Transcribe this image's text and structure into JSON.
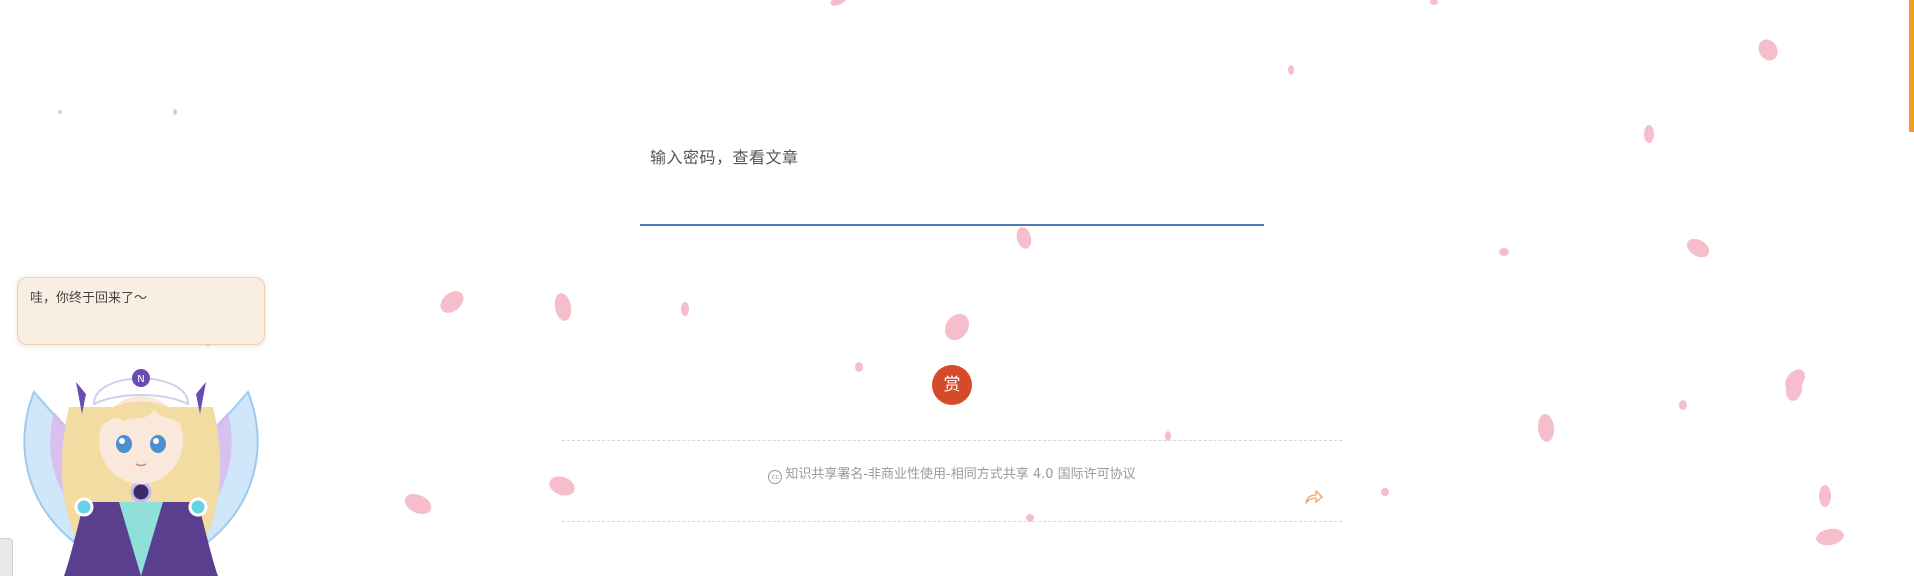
{
  "password_form": {
    "label": "输入密码，查看文章",
    "input_value": ""
  },
  "donate": {
    "label": "赏",
    "color": "#d44a2a"
  },
  "license": {
    "icon": "creative-commons-icon",
    "text": "知识共享署名-非商业性使用-相同方式共享 4.0 国际许可协议",
    "share_icon": "share-arrow-icon"
  },
  "mascot": {
    "greeting": "哇，你终于回来了～"
  },
  "theme": {
    "accent_line": "#4f7ab2",
    "scroll_indicator": "#f59a23",
    "bubble_bg": "#f8efe2",
    "petal": "#f6b6c6"
  }
}
